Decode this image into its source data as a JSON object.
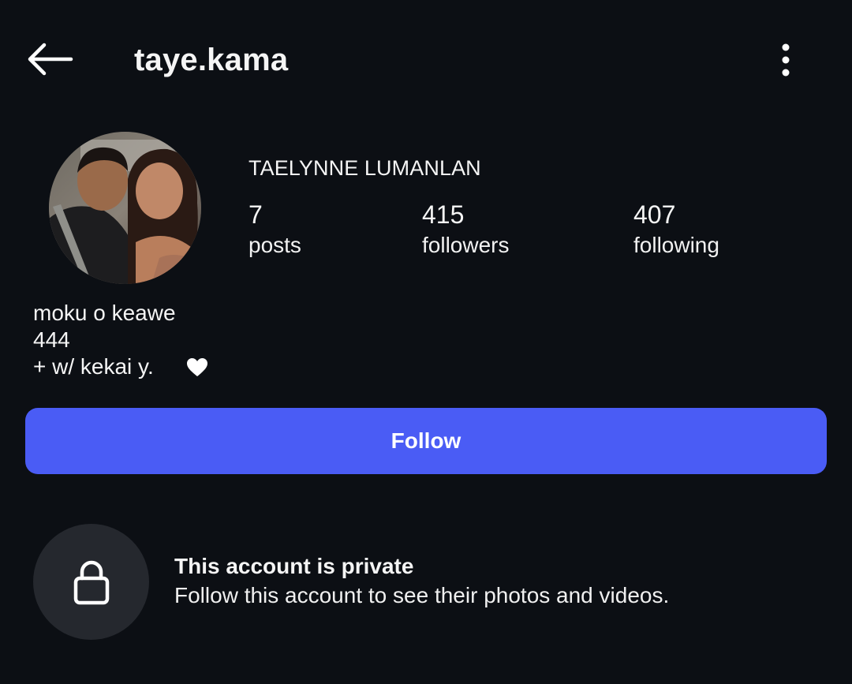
{
  "header": {
    "back_icon": "arrow-left-icon",
    "username": "taye.kama",
    "more_icon": "more-vertical-icon"
  },
  "profile": {
    "avatar_description": "profile-photo",
    "full_name": "TAELYNNE LUMANLAN",
    "stats": [
      {
        "value": "7",
        "label": "posts"
      },
      {
        "value": "415",
        "label": "followers"
      },
      {
        "value": "407",
        "label": "following"
      }
    ],
    "bio_lines": [
      "moku o keawe",
      "444",
      "+ w/ kekai y."
    ],
    "bio_emoji_icon": "heart-icon"
  },
  "actions": {
    "follow_label": "Follow"
  },
  "private_notice": {
    "icon": "lock-icon",
    "title": "This account is private",
    "subtitle": "Follow this account to see their photos and videos."
  },
  "colors": {
    "background": "#0c0f14",
    "accent": "#4a5cf5",
    "lock_circle": "#25282e"
  }
}
